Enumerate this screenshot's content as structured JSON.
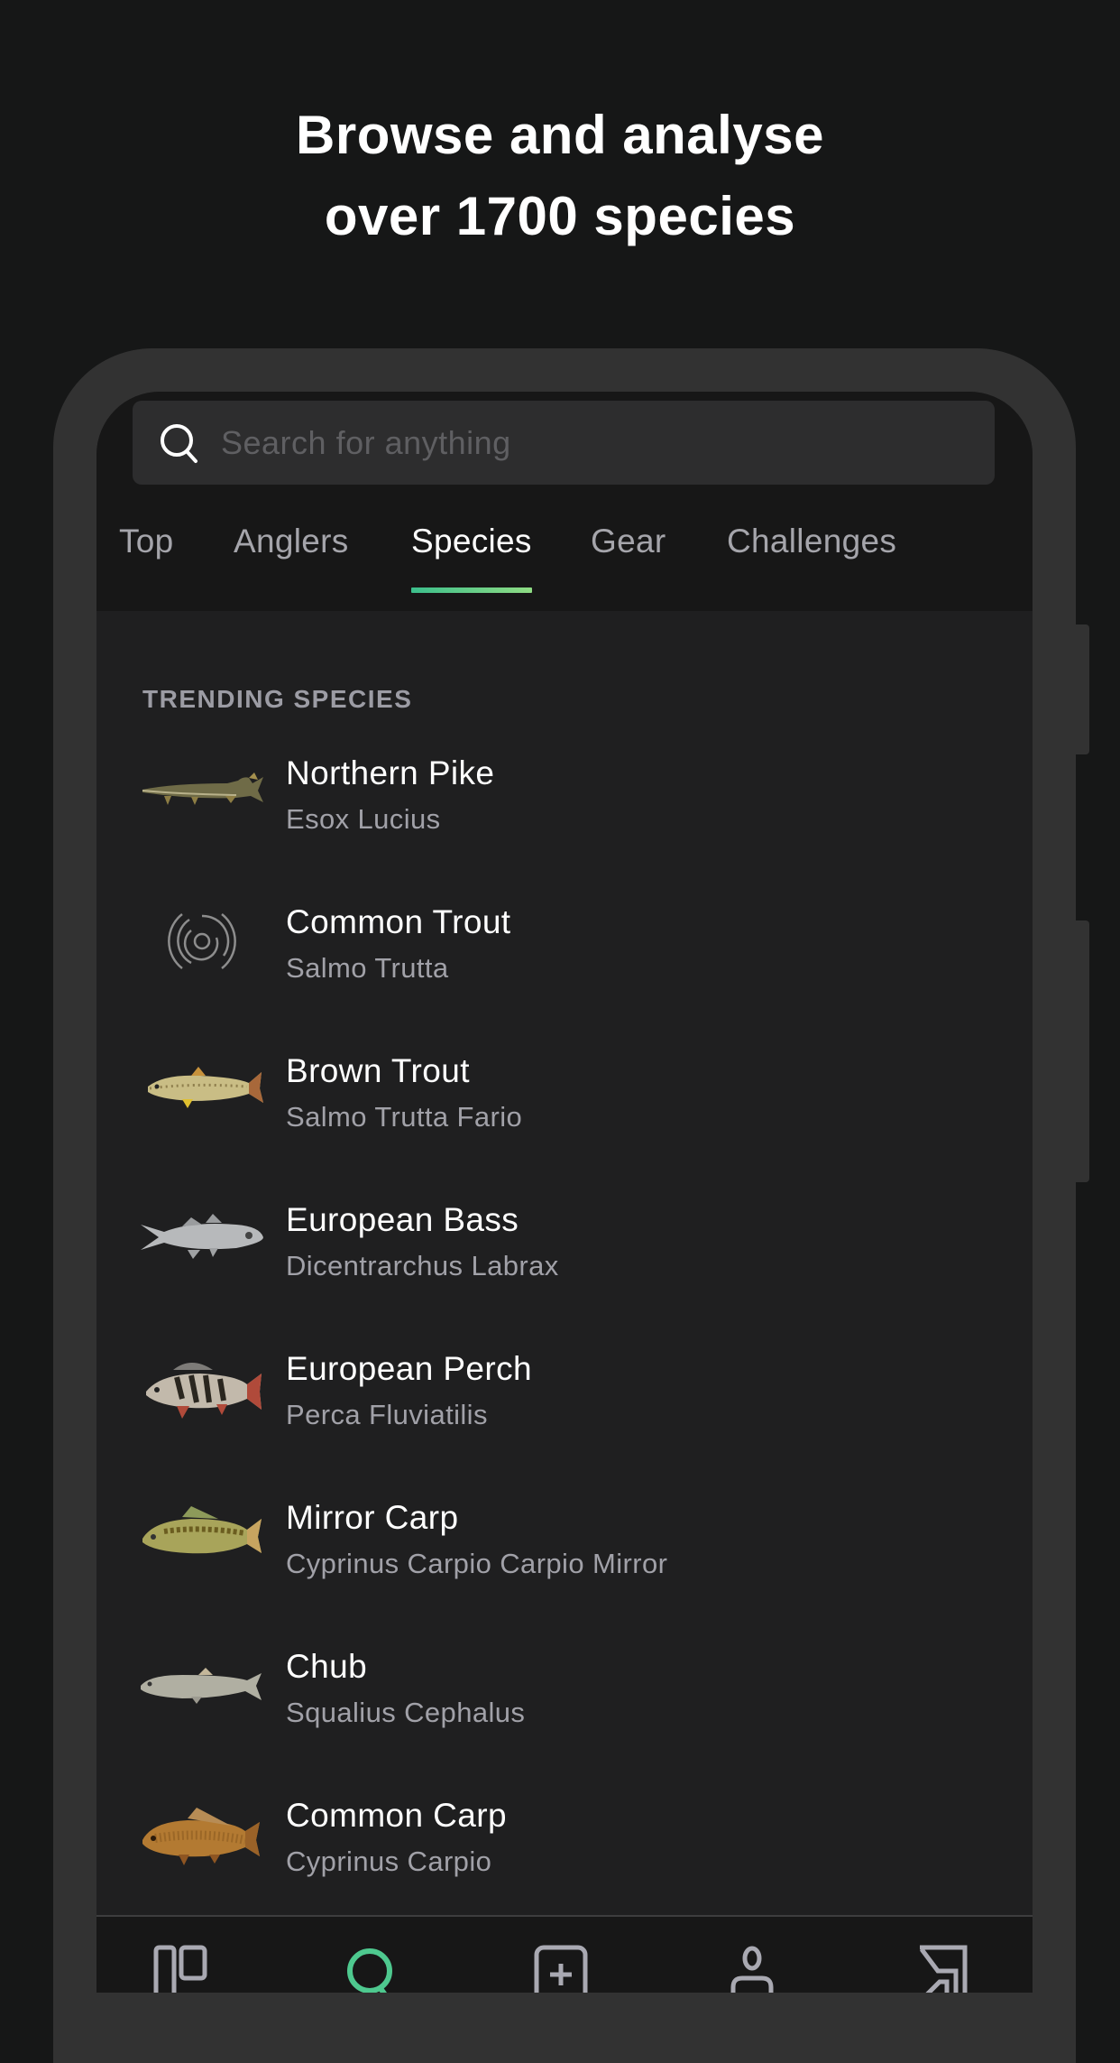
{
  "headline": {
    "line1": "Browse and analyse",
    "line2": "over 1700 species"
  },
  "search": {
    "icon": "search-icon",
    "placeholder": "Search for anything"
  },
  "tabs": [
    {
      "label": "Top",
      "active": false
    },
    {
      "label": "Anglers",
      "active": false
    },
    {
      "label": "Species",
      "active": true
    },
    {
      "label": "Gear",
      "active": false
    },
    {
      "label": "Challenges",
      "active": false
    }
  ],
  "section": {
    "title": "TRENDING SPECIES"
  },
  "species": [
    {
      "name": "Northern Pike",
      "scientific": "Esox Lucius",
      "image": "pike-fish-image"
    },
    {
      "name": "Common Trout",
      "scientific": "Salmo Trutta",
      "image": "placeholder-ripple-icon"
    },
    {
      "name": "Brown Trout",
      "scientific": "Salmo Trutta Fario",
      "image": "brown-trout-fish-image"
    },
    {
      "name": "European Bass",
      "scientific": "Dicentrarchus Labrax",
      "image": "bass-fish-image"
    },
    {
      "name": "European Perch",
      "scientific": "Perca Fluviatilis",
      "image": "perch-fish-image"
    },
    {
      "name": "Mirror Carp",
      "scientific": "Cyprinus Carpio Carpio Mirror",
      "image": "mirror-carp-fish-image"
    },
    {
      "name": "Chub",
      "scientific": "Squalius Cephalus",
      "image": "chub-fish-image"
    },
    {
      "name": "Common Carp",
      "scientific": "Cyprinus Carpio",
      "image": "common-carp-fish-image"
    }
  ],
  "bottom_nav": [
    {
      "icon": "feed-icon",
      "active": false
    },
    {
      "icon": "search-icon",
      "active": true
    },
    {
      "icon": "add-catch-icon",
      "active": false
    },
    {
      "icon": "profile-icon",
      "active": false
    },
    {
      "icon": "map-icon",
      "active": false
    }
  ],
  "colors": {
    "background": "#161717",
    "accent_green": "#3cbf8c",
    "accent_green_light": "#8fdc84",
    "text_primary": "#ffffff",
    "text_secondary": "#a1a1a8"
  }
}
